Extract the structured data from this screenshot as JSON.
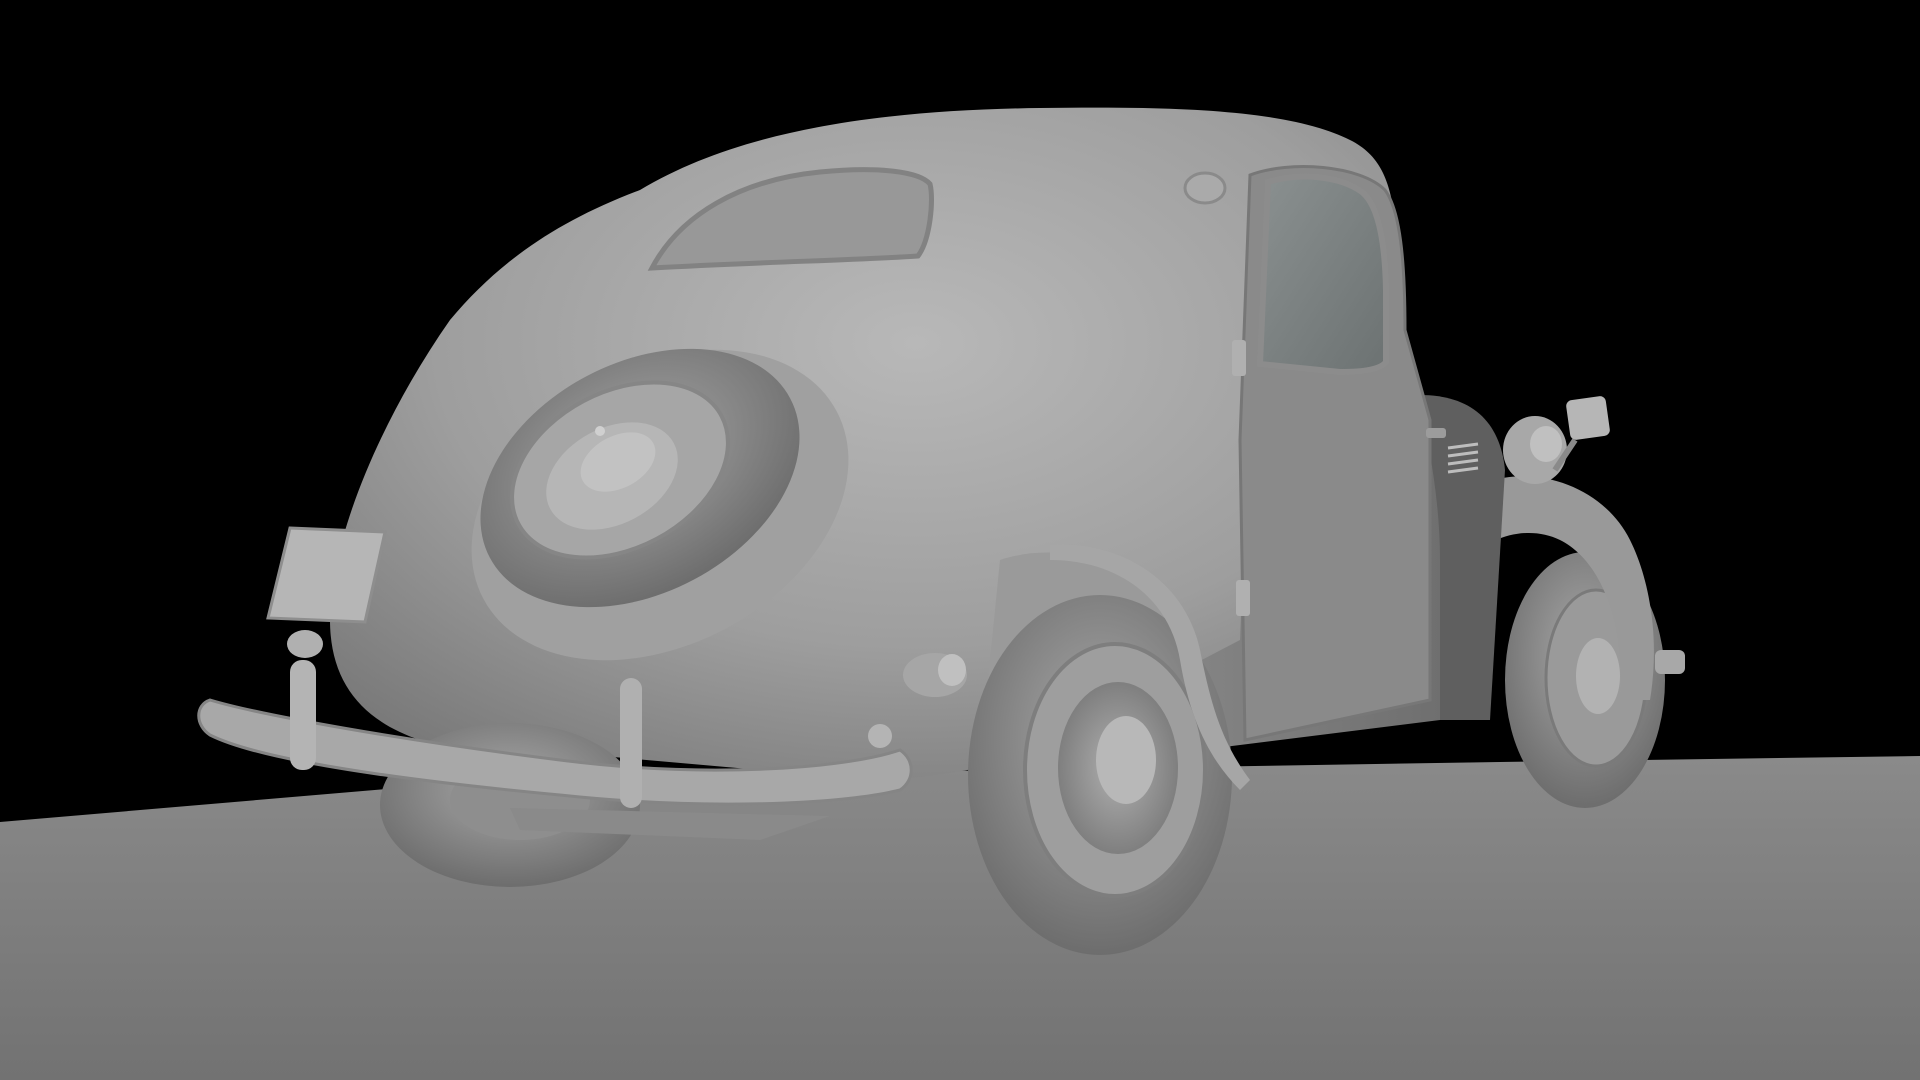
{
  "scene": {
    "subject": "car-3d-model-render",
    "colors": {
      "background": "#000000",
      "ground_plane": "#7d7d7d",
      "body_base": "#9a9a9a",
      "body_highlight": "#b4b4b4",
      "body_shadow": "#6e6e6e",
      "window_glass": "#7a8080"
    }
  }
}
